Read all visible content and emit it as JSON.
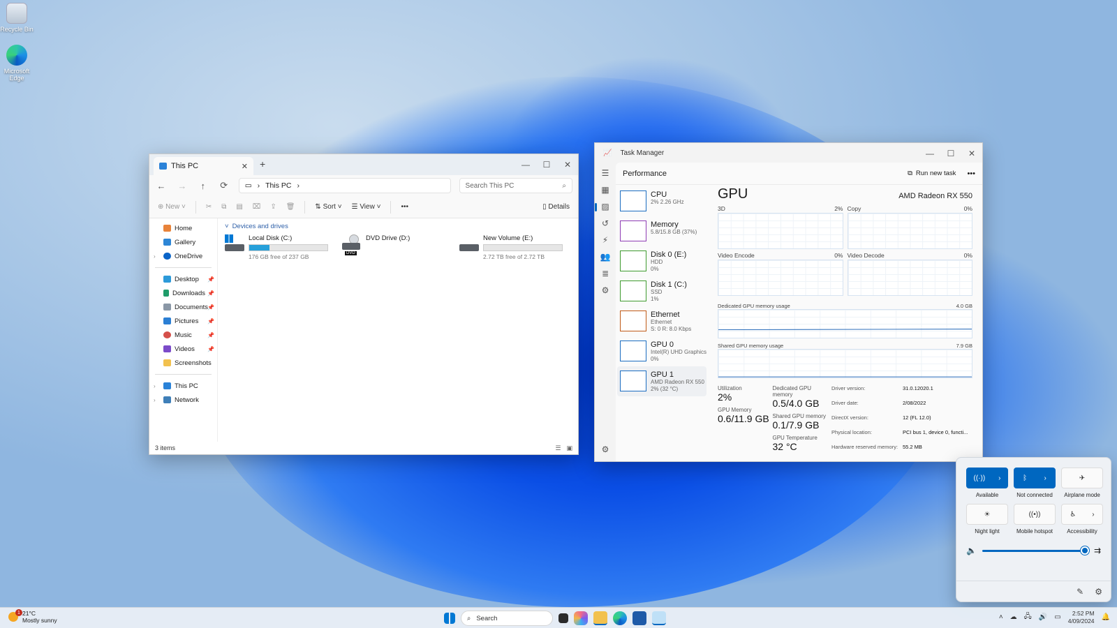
{
  "desktop": {
    "icons": [
      {
        "label": "Recycle Bin"
      },
      {
        "label": "Microsoft Edge"
      }
    ]
  },
  "explorer": {
    "tab_title": "This PC",
    "address": {
      "location": "This PC"
    },
    "search_placeholder": "Search This PC",
    "commands": {
      "new": "New",
      "sort": "Sort",
      "view": "View",
      "more": "•••",
      "details": "Details"
    },
    "nav": {
      "home": "Home",
      "gallery": "Gallery",
      "onedrive": "OneDrive",
      "desktop": "Desktop",
      "downloads": "Downloads",
      "documents": "Documents",
      "pictures": "Pictures",
      "music": "Music",
      "videos": "Videos",
      "screenshots": "Screenshots",
      "thispc": "This PC",
      "network": "Network"
    },
    "group_header": "Devices and drives",
    "drives": [
      {
        "name": "Local Disk (C:)",
        "free": "176 GB free of 237 GB",
        "used_fraction": 0.26
      },
      {
        "name": "DVD Drive (D:)",
        "badge": "DVD"
      },
      {
        "name": "New Volume (E:)",
        "free": "2.72 TB free of 2.72 TB",
        "used_fraction": 0.0
      }
    ],
    "status": "3 items"
  },
  "taskmanager": {
    "title": "Task Manager",
    "section": "Performance",
    "run_new_task": "Run new task",
    "more": "•••",
    "resources": [
      {
        "name": "CPU",
        "l2": "2% 2.26 GHz",
        "l3": ""
      },
      {
        "name": "Memory",
        "l2": "5.8/15.8 GB (37%)",
        "l3": ""
      },
      {
        "name": "Disk 0 (E:)",
        "l2": "HDD",
        "l3": "0%"
      },
      {
        "name": "Disk 1 (C:)",
        "l2": "SSD",
        "l3": "1%"
      },
      {
        "name": "Ethernet",
        "l2": "Ethernet",
        "l3": "S: 0 R: 8.0 Kbps"
      },
      {
        "name": "GPU 0",
        "l2": "Intel(R) UHD Graphics ...",
        "l3": "0%"
      },
      {
        "name": "GPU 1",
        "l2": "AMD Radeon RX 550",
        "l3": "2% (32 °C)"
      }
    ],
    "gpu": {
      "title": "GPU",
      "model": "AMD Radeon RX 550",
      "engines": [
        {
          "name": "3D",
          "pct": "2%"
        },
        {
          "name": "Copy",
          "pct": "0%"
        },
        {
          "name": "Video Encode",
          "pct": "0%"
        },
        {
          "name": "Video Decode",
          "pct": "0%"
        }
      ],
      "dedicated_label": "Dedicated GPU memory usage",
      "dedicated_max": "4.0 GB",
      "shared_label": "Shared GPU memory usage",
      "shared_max": "7.9 GB",
      "stats": {
        "utilization_label": "Utilization",
        "utilization": "2%",
        "gpu_memory_label": "GPU Memory",
        "gpu_memory": "0.6/11.9 GB",
        "dedicated_label": "Dedicated GPU memory",
        "dedicated": "0.5/4.0 GB",
        "shared_label": "Shared GPU memory",
        "shared": "0.1/7.9 GB",
        "temp_label": "GPU Temperature",
        "temp": "32 °C"
      },
      "details": [
        {
          "k": "Driver version:",
          "v": "31.0.12020.1"
        },
        {
          "k": "Driver date:",
          "v": "2/08/2022"
        },
        {
          "k": "DirectX version:",
          "v": "12 (FL 12.0)"
        },
        {
          "k": "Physical location:",
          "v": "PCI bus 1, device 0, functi..."
        },
        {
          "k": "Hardware reserved memory:",
          "v": "55.2 MB"
        }
      ]
    }
  },
  "quick_settings": {
    "tiles": [
      {
        "label": "Available",
        "on": true
      },
      {
        "label": "Not connected",
        "on": true
      },
      {
        "label": "Airplane mode",
        "on": false
      },
      {
        "label": "Night light",
        "on": false
      },
      {
        "label": "Mobile hotspot",
        "on": false
      },
      {
        "label": "Accessibility",
        "on": false
      }
    ],
    "volume_level": 0.97
  },
  "taskbar": {
    "weather_temp": "21°C",
    "weather_desc": "Mostly sunny",
    "weather_badge": "1",
    "search": "Search",
    "time": "2:52 PM",
    "date": "4/09/2024"
  },
  "colors": {
    "accent": "#0067c0",
    "drive_fill": "#26a0da"
  }
}
